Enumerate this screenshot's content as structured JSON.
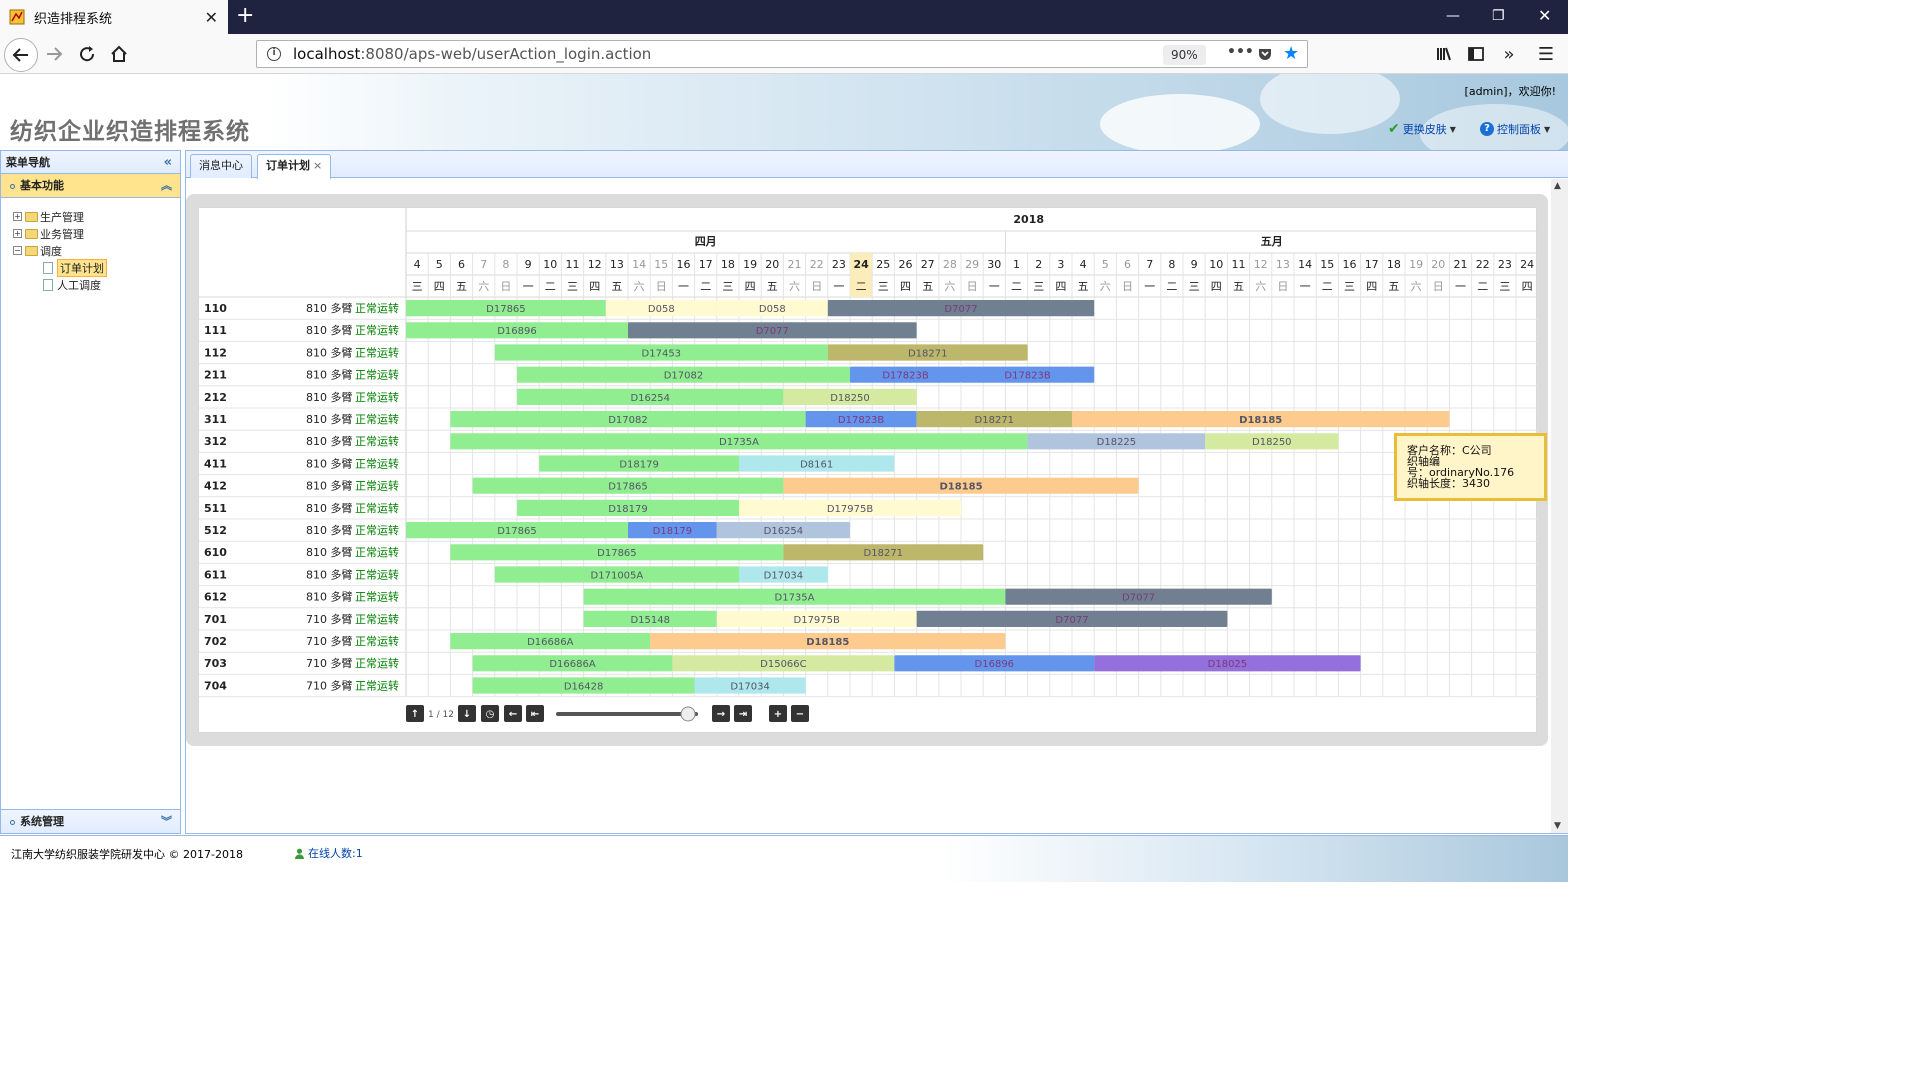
{
  "browser": {
    "tab_title": "织造排程系统",
    "url_host": "localhost",
    "url_rest": ":8080/aps-web/userAction_login.action",
    "zoom": "90%"
  },
  "header": {
    "title": "纺织企业织造排程系统",
    "welcome": "[admin]，欢迎你!",
    "skin_label": "更换皮肤",
    "panel_label": "控制面板"
  },
  "sidebar": {
    "title": "菜单导航",
    "section_basic": "基本功能",
    "tree": [
      {
        "label": "生产管理",
        "expanded": false
      },
      {
        "label": "业务管理",
        "expanded": false
      },
      {
        "label": "调度",
        "expanded": true,
        "children": [
          {
            "label": "订单计划",
            "selected": true
          },
          {
            "label": "人工调度",
            "selected": false
          }
        ]
      }
    ],
    "section_system": "系统管理"
  },
  "content_tabs": [
    {
      "label": "消息中心",
      "active": false,
      "closable": false
    },
    {
      "label": "订单计划",
      "active": true,
      "closable": true
    }
  ],
  "chart_data": {
    "type": "gantt",
    "year": "2018",
    "months": [
      {
        "label": "四月",
        "start_index": 0,
        "days": 27
      },
      {
        "label": "五月",
        "start_index": 27,
        "days": 24
      }
    ],
    "days": [
      "4",
      "5",
      "6",
      "7",
      "8",
      "9",
      "10",
      "11",
      "12",
      "13",
      "14",
      "15",
      "16",
      "17",
      "18",
      "19",
      "20",
      "21",
      "22",
      "23",
      "24",
      "25",
      "26",
      "27",
      "28",
      "29",
      "30",
      "1",
      "2",
      "3",
      "4",
      "5",
      "6",
      "7",
      "8",
      "9",
      "10",
      "11",
      "12",
      "13",
      "14",
      "15",
      "16",
      "17",
      "18",
      "19",
      "20",
      "21",
      "22",
      "23",
      "24"
    ],
    "weekdays": [
      "三",
      "四",
      "五",
      "六",
      "日",
      "一",
      "二",
      "三",
      "四",
      "五",
      "六",
      "日",
      "一",
      "二",
      "三",
      "四",
      "五",
      "六",
      "日",
      "一",
      "二",
      "三",
      "四",
      "五",
      "六",
      "日",
      "一",
      "二",
      "三",
      "四",
      "五",
      "六",
      "日",
      "一",
      "二",
      "三",
      "四",
      "五",
      "六",
      "日",
      "一",
      "二",
      "三",
      "四",
      "五",
      "六",
      "日",
      "一",
      "二",
      "三",
      "四"
    ],
    "today_index": 20,
    "rows": [
      {
        "machine": "110",
        "spec": "810 多臂",
        "status": "正常运转",
        "tasks": [
          {
            "order": "D17865",
            "start": 0,
            "end": 9,
            "color": "#90ee90"
          },
          {
            "order": "D058",
            "start": 9,
            "end": 14,
            "color": "#fffad0"
          },
          {
            "order": "D058",
            "start": 14,
            "end": 19,
            "color": "#fffad0"
          },
          {
            "order": "D7077",
            "start": 19,
            "end": 31,
            "color": "#708090"
          }
        ]
      },
      {
        "machine": "111",
        "spec": "810 多臂",
        "status": "正常运转",
        "tasks": [
          {
            "order": "D16896",
            "start": 0,
            "end": 10,
            "color": "#90ee90"
          },
          {
            "order": "D7077",
            "start": 10,
            "end": 23,
            "color": "#708090"
          }
        ]
      },
      {
        "machine": "112",
        "spec": "810 多臂",
        "status": "正常运转",
        "tasks": [
          {
            "order": "D17453",
            "start": 4,
            "end": 19,
            "color": "#90ee90"
          },
          {
            "order": "D18271",
            "start": 19,
            "end": 28,
            "color": "#bdb76b"
          }
        ]
      },
      {
        "machine": "211",
        "spec": "810 多臂",
        "status": "正常运转",
        "tasks": [
          {
            "order": "D17082",
            "start": 5,
            "end": 20,
            "color": "#90ee90"
          },
          {
            "order": "D17823B",
            "start": 20,
            "end": 25,
            "color": "#6495ed"
          },
          {
            "order": "D17823B",
            "start": 25,
            "end": 31,
            "color": "#6495ed"
          }
        ]
      },
      {
        "machine": "212",
        "spec": "810 多臂",
        "status": "正常运转",
        "tasks": [
          {
            "order": "D16254",
            "start": 5,
            "end": 17,
            "color": "#90ee90"
          },
          {
            "order": "D18250",
            "start": 17,
            "end": 23,
            "color": "#d4eaa0"
          }
        ]
      },
      {
        "machine": "311",
        "spec": "810 多臂",
        "status": "正常运转",
        "tasks": [
          {
            "order": "D17082",
            "start": 2,
            "end": 18,
            "color": "#90ee90"
          },
          {
            "order": "D17823B",
            "start": 18,
            "end": 23,
            "color": "#6495ed"
          },
          {
            "order": "D18271",
            "start": 23,
            "end": 30,
            "color": "#bdb76b"
          },
          {
            "order": "D18185",
            "start": 30,
            "end": 47,
            "color": "#fdcb8e"
          }
        ]
      },
      {
        "machine": "312",
        "spec": "810 多臂",
        "status": "正常运转",
        "tasks": [
          {
            "order": "D1735A",
            "start": 2,
            "end": 28,
            "color": "#90ee90"
          },
          {
            "order": "D18225",
            "start": 28,
            "end": 36,
            "color": "#b0c4de"
          },
          {
            "order": "D18250",
            "start": 36,
            "end": 42,
            "color": "#d4eaa0"
          }
        ]
      },
      {
        "machine": "411",
        "spec": "810 多臂",
        "status": "正常运转",
        "tasks": [
          {
            "order": "D18179",
            "start": 6,
            "end": 15,
            "color": "#90ee90"
          },
          {
            "order": "D8161",
            "start": 15,
            "end": 22,
            "color": "#aee8ec"
          }
        ]
      },
      {
        "machine": "412",
        "spec": "810 多臂",
        "status": "正常运转",
        "tasks": [
          {
            "order": "D17865",
            "start": 3,
            "end": 17,
            "color": "#90ee90"
          },
          {
            "order": "D18185",
            "start": 17,
            "end": 33,
            "color": "#fdcb8e"
          }
        ]
      },
      {
        "machine": "511",
        "spec": "810 多臂",
        "status": "正常运转",
        "tasks": [
          {
            "order": "D18179",
            "start": 5,
            "end": 15,
            "color": "#90ee90"
          },
          {
            "order": "D17975B",
            "start": 15,
            "end": 25,
            "color": "#fffad0"
          }
        ]
      },
      {
        "machine": "512",
        "spec": "810 多臂",
        "status": "正常运转",
        "tasks": [
          {
            "order": "D17865",
            "start": 0,
            "end": 10,
            "color": "#90ee90"
          },
          {
            "order": "D18179",
            "start": 10,
            "end": 14,
            "color": "#6495ed"
          },
          {
            "order": "D16254",
            "start": 14,
            "end": 20,
            "color": "#b0c4de"
          }
        ]
      },
      {
        "machine": "610",
        "spec": "810 多臂",
        "status": "正常运转",
        "tasks": [
          {
            "order": "D17865",
            "start": 2,
            "end": 17,
            "color": "#90ee90"
          },
          {
            "order": "D18271",
            "start": 17,
            "end": 26,
            "color": "#bdb76b"
          }
        ]
      },
      {
        "machine": "611",
        "spec": "810 多臂",
        "status": "正常运转",
        "tasks": [
          {
            "order": "D171005A",
            "start": 4,
            "end": 15,
            "color": "#90ee90"
          },
          {
            "order": "D17034",
            "start": 15,
            "end": 19,
            "color": "#aee8ec"
          }
        ]
      },
      {
        "machine": "612",
        "spec": "810 多臂",
        "status": "正常运转",
        "tasks": [
          {
            "order": "D1735A",
            "start": 8,
            "end": 27,
            "color": "#90ee90"
          },
          {
            "order": "D7077",
            "start": 27,
            "end": 39,
            "color": "#708090"
          }
        ]
      },
      {
        "machine": "701",
        "spec": "710 多臂",
        "status": "正常运转",
        "tasks": [
          {
            "order": "D15148",
            "start": 8,
            "end": 14,
            "color": "#90ee90"
          },
          {
            "order": "D17975B",
            "start": 14,
            "end": 23,
            "color": "#fffad0"
          },
          {
            "order": "D7077",
            "start": 23,
            "end": 37,
            "color": "#708090"
          }
        ]
      },
      {
        "machine": "702",
        "spec": "710 多臂",
        "status": "正常运转",
        "tasks": [
          {
            "order": "D16686A",
            "start": 2,
            "end": 11,
            "color": "#90ee90"
          },
          {
            "order": "D18185",
            "start": 11,
            "end": 27,
            "color": "#fdcb8e"
          }
        ]
      },
      {
        "machine": "703",
        "spec": "710 多臂",
        "status": "正常运转",
        "tasks": [
          {
            "order": "D16686A",
            "start": 3,
            "end": 12,
            "color": "#90ee90"
          },
          {
            "order": "D15066C",
            "start": 12,
            "end": 22,
            "color": "#d4eaa0"
          },
          {
            "order": "D16896",
            "start": 22,
            "end": 31,
            "color": "#6495ed"
          },
          {
            "order": "D18025",
            "start": 31,
            "end": 43,
            "color": "#9370db"
          }
        ]
      },
      {
        "machine": "704",
        "spec": "710 多臂",
        "status": "正常运转",
        "tasks": [
          {
            "order": "D16428",
            "start": 3,
            "end": 13,
            "color": "#90ee90"
          },
          {
            "order": "D17034",
            "start": 13,
            "end": 18,
            "color": "#aee8ec"
          }
        ]
      }
    ]
  },
  "gantt_controls": {
    "page": "1 / 12",
    "zoom_slider_value": 0.93
  },
  "tooltip": {
    "line1": "客户名称：C公司",
    "line2": "织轴编",
    "line3": "号：ordinaryNo.176",
    "line4": "织轴长度：3430"
  },
  "footer": {
    "copyright": "江南大学纺织服装学院研发中心 © 2017-2018",
    "online": "在线人数:1"
  },
  "colors": {
    "accent_border": "#95b8e7",
    "status_ok": "#008000",
    "selected_bg": "#ffe48d"
  }
}
